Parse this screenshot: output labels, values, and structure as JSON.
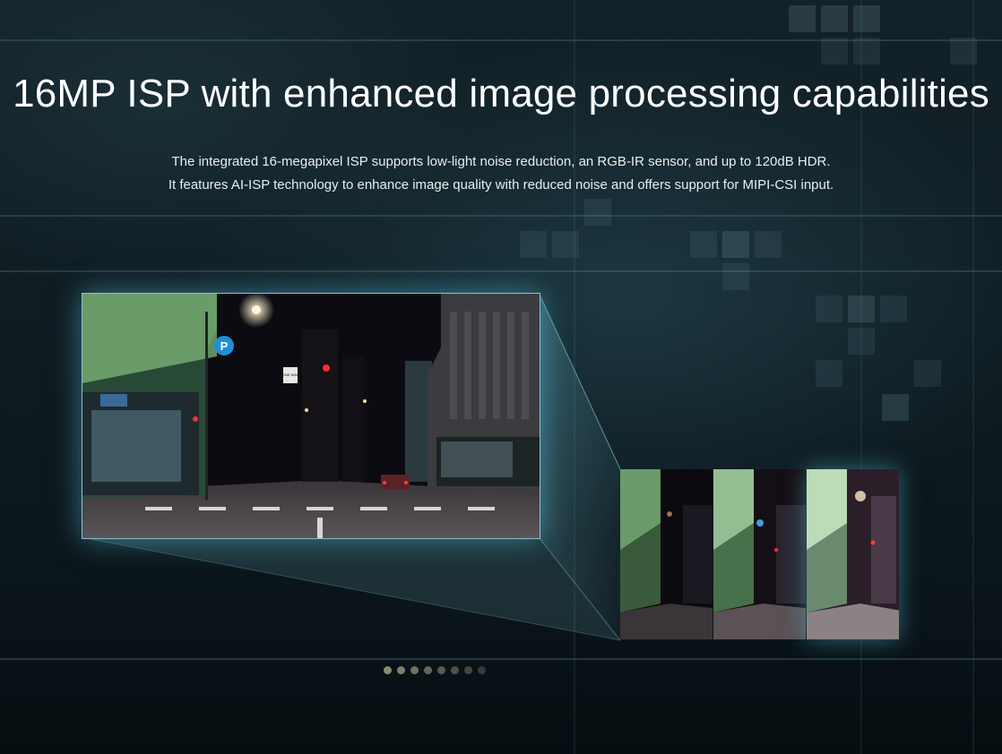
{
  "headline": "16MP ISP with enhanced image processing capabilities",
  "description": {
    "line1": "The integrated 16-megapixel ISP supports low-light noise reduction, an RGB-IR sensor, and up to 120dB HDR.",
    "line2": "It features AI-ISP technology to enhance image quality with reduced noise and offers support for MIPI-CSI input."
  },
  "main_photo": {
    "parking_sign": "P",
    "one_way_sign": "ONE WAY"
  },
  "comparison_thumbnails": [
    {
      "tone": "dark"
    },
    {
      "tone": "mid"
    },
    {
      "tone": "bright"
    }
  ],
  "carousel": {
    "dot_count": 8,
    "colors": [
      "#8a8a70",
      "#7e7f6b",
      "#717262",
      "#65675a",
      "#595b52",
      "#4e5049",
      "#434541",
      "#393b39"
    ]
  },
  "colors": {
    "accent_glow": "#5abedc",
    "background": "#0a1419",
    "text": "#ffffff"
  }
}
